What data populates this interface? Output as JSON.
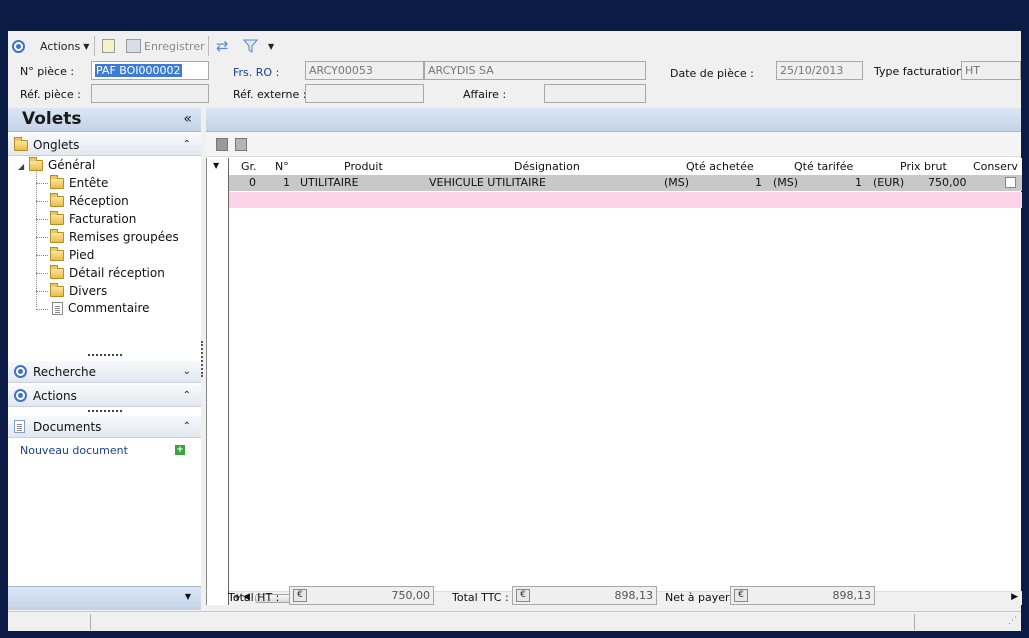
{
  "toolbar": {
    "actions_label": "Actions",
    "save_label": "Enregistrer"
  },
  "header": {
    "num_piece_label": "N° pièce :",
    "num_piece_value": "PAF BOI000002",
    "ref_piece_label": "Réf. pièce :",
    "ref_piece_value": "",
    "frs_label": "Frs. RO :",
    "frs_code": "ARCY00053",
    "frs_name": "ARCYDIS SA",
    "ref_externe_label": "Réf. externe :",
    "ref_externe_value": "",
    "affaire_label": "Affaire :",
    "affaire_value": "",
    "date_label": "Date de pièce :",
    "date_value": "25/10/2013",
    "type_label": "Type facturation :",
    "type_value": "HT"
  },
  "left_panel": {
    "title": "Volets",
    "onglets_label": "Onglets",
    "tree": {
      "root": "Général",
      "children": [
        "Entête",
        "Réception",
        "Facturation",
        "Remises groupées",
        "Pied",
        "Détail réception",
        "Divers",
        "Commentaire"
      ]
    },
    "recherche_label": "Recherche",
    "actions_label": "Actions",
    "documents_label": "Documents",
    "new_document_label": "Nouveau document"
  },
  "grid": {
    "columns": [
      "Gr.",
      "N°",
      "Produit",
      "Désignation",
      "Qté achetée",
      "Qté tarifée",
      "Prix brut",
      "Conserv"
    ],
    "rows": [
      {
        "gr": "0",
        "num": "1",
        "produit": "UTILITAIRE",
        "designation": "VEHICULE UTILITAIRE",
        "unit_achetee": "(MS)",
        "qte_achetee": "1",
        "unit_tarifee": "(MS)",
        "qte_tarifee": "1",
        "devise": "(EUR)",
        "prix_brut": "750,00"
      }
    ]
  },
  "totals": {
    "ht_label": "Total HT :",
    "ht_value": "750,00",
    "ttc_label": "Total TTC :",
    "ttc_value": "898,13",
    "net_label": "Net à payer :",
    "net_value": "898,13",
    "currency_symbol": "€"
  },
  "colors": {
    "background": "#0b1b45",
    "selected_row": "#c8c8c8",
    "new_row": "#fbd3e6",
    "selection": "#3d7bd9"
  }
}
